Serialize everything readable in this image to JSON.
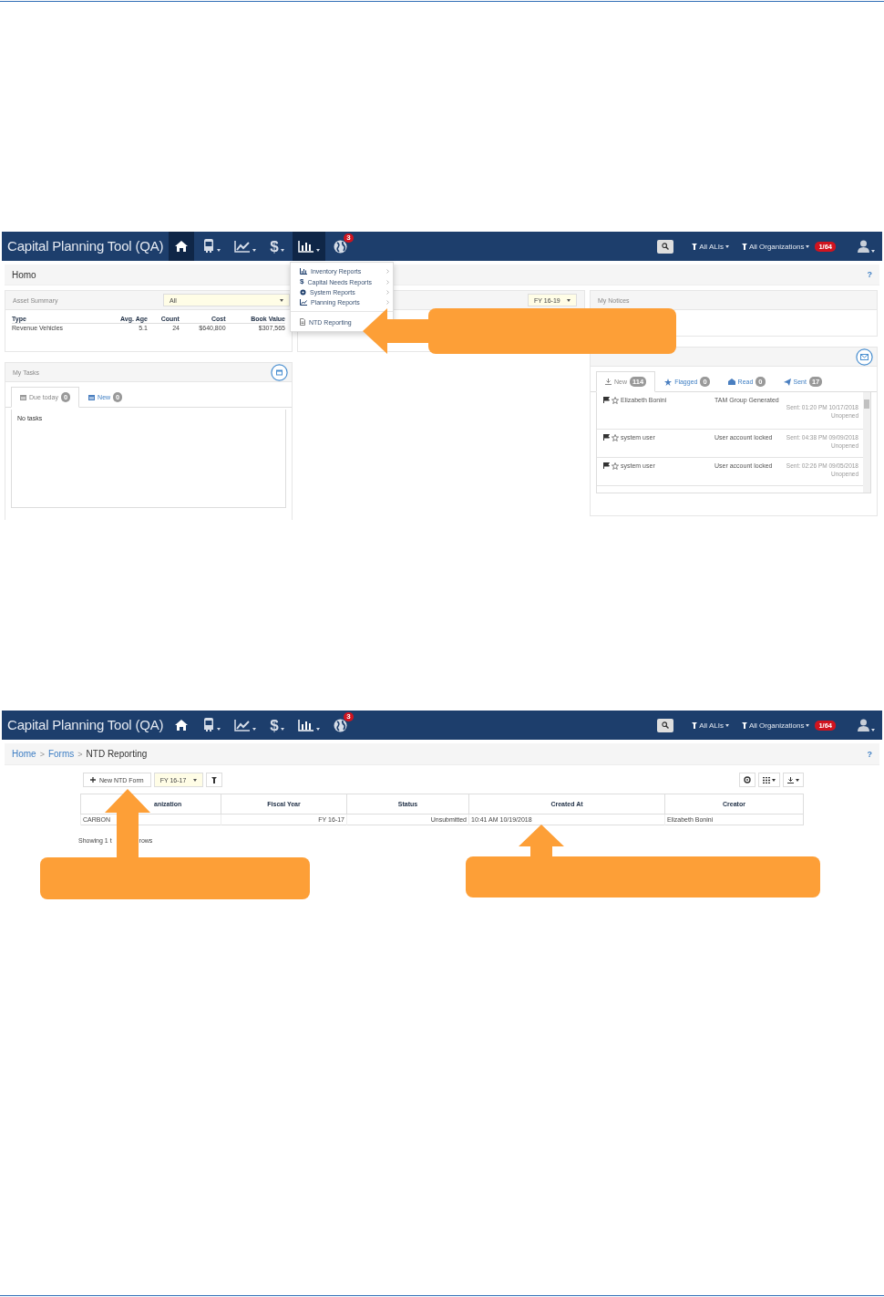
{
  "screenshots": [
    {
      "kind": "dashboard",
      "navbar": {
        "title": "Capital Planning Tool (QA)",
        "menus": [
          {
            "kind": "home",
            "selected": true,
            "caret": false
          },
          {
            "kind": "bus",
            "selected": false,
            "caret": true
          },
          {
            "kind": "chart",
            "selected": false,
            "caret": true
          },
          {
            "kind": "dollar",
            "selected": false,
            "caret": true,
            "glyph": "$"
          },
          {
            "kind": "reports",
            "selected": true,
            "caret": true
          },
          {
            "kind": "globe",
            "selected": false,
            "caret": false,
            "badge": "3"
          }
        ],
        "filters": [
          {
            "label": "All ALIs"
          },
          {
            "label": "All Organizations",
            "badge": "1/64"
          }
        ]
      },
      "page_header": {
        "title": "Homo",
        "help": "?"
      },
      "dropdown": {
        "groups": [
          [
            {
              "kind": "inventory",
              "label": "Inventory Reports",
              "submenu": true
            },
            {
              "kind": "capital",
              "glyph": "$",
              "label": "Capital Needs Reports",
              "submenu": true
            },
            {
              "kind": "system",
              "label": "System Reports",
              "submenu": true
            },
            {
              "kind": "planning",
              "label": "Planning Reports",
              "submenu": true
            }
          ],
          [
            {
              "kind": "ntd",
              "label": "NTD Reporting",
              "submenu": false
            }
          ]
        ]
      },
      "asset_summary": {
        "title": "Asset Summary",
        "filter": "All",
        "columns": [
          "Type",
          "Avg. Age",
          "Count",
          "Cost",
          "Book Value"
        ],
        "rows": [
          [
            "Revenue Vehicles",
            "5.1",
            "24",
            "$640,800",
            "$307,565"
          ]
        ]
      },
      "middle_panel": {
        "filter": "FY 16-19"
      },
      "notices": {
        "title": "My Notices"
      },
      "tasks": {
        "title": "My Tasks",
        "tabs": [
          {
            "label": "Due today",
            "count": "0",
            "selected": true
          },
          {
            "label": "New",
            "count": "0",
            "selected": false
          }
        ],
        "empty_text": "No tasks"
      },
      "messages": {
        "tabs": [
          {
            "kind": "new",
            "label": "New",
            "count": "114",
            "selected": true
          },
          {
            "kind": "flagged",
            "label": "Flagged",
            "count": "0",
            "selected": false
          },
          {
            "kind": "read",
            "label": "Read",
            "count": "0",
            "selected": false
          },
          {
            "kind": "sent",
            "label": "Sent",
            "count": "17",
            "selected": false
          }
        ],
        "rows": [
          {
            "sender": "Elizabeth Bonini",
            "subject": "TAM Group Generated",
            "sent": "Sent: 01:20 PM 10/17/2018",
            "status": "Unopened"
          },
          {
            "sender": "system user",
            "subject": "User account locked",
            "sent": "Sent: 04:38 PM 09/09/2018",
            "status": "Unopened"
          },
          {
            "sender": "system user",
            "subject": "User account locked",
            "sent": "Sent: 02:26 PM 09/05/2018",
            "status": "Unopened"
          }
        ]
      }
    },
    {
      "kind": "ntd",
      "navbar": {
        "title": "Capital Planning Tool (QA)",
        "menus": [
          {
            "kind": "home",
            "selected": false,
            "caret": false
          },
          {
            "kind": "bus",
            "selected": false,
            "caret": true
          },
          {
            "kind": "chart",
            "selected": false,
            "caret": true
          },
          {
            "kind": "dollar",
            "selected": false,
            "caret": true,
            "glyph": "$"
          },
          {
            "kind": "reports",
            "selected": false,
            "caret": true
          },
          {
            "kind": "globe",
            "selected": false,
            "caret": false,
            "badge": "3"
          }
        ],
        "filters": [
          {
            "label": "All ALIs"
          },
          {
            "label": "All Organizations",
            "badge": "1/64"
          }
        ]
      },
      "breadcrumb": {
        "links": [
          "Home",
          "Forms"
        ],
        "separator": ">",
        "current": "NTD Reporting",
        "help": "?"
      },
      "toolbar": {
        "new_button": "New NTD Form",
        "fiscal_year": "FY 16-17"
      },
      "table": {
        "columns": [
          "anization",
          "Fiscal Year",
          "Status",
          "Created At",
          "Creator"
        ],
        "rows": [
          [
            "CARBON",
            "FY 16-17",
            "Unsubmitted",
            "10:41 AM 10/19/2018",
            "Elizabeth Bonini"
          ]
        ]
      },
      "footer": [
        "Showing 1 t",
        "rows"
      ]
    }
  ]
}
